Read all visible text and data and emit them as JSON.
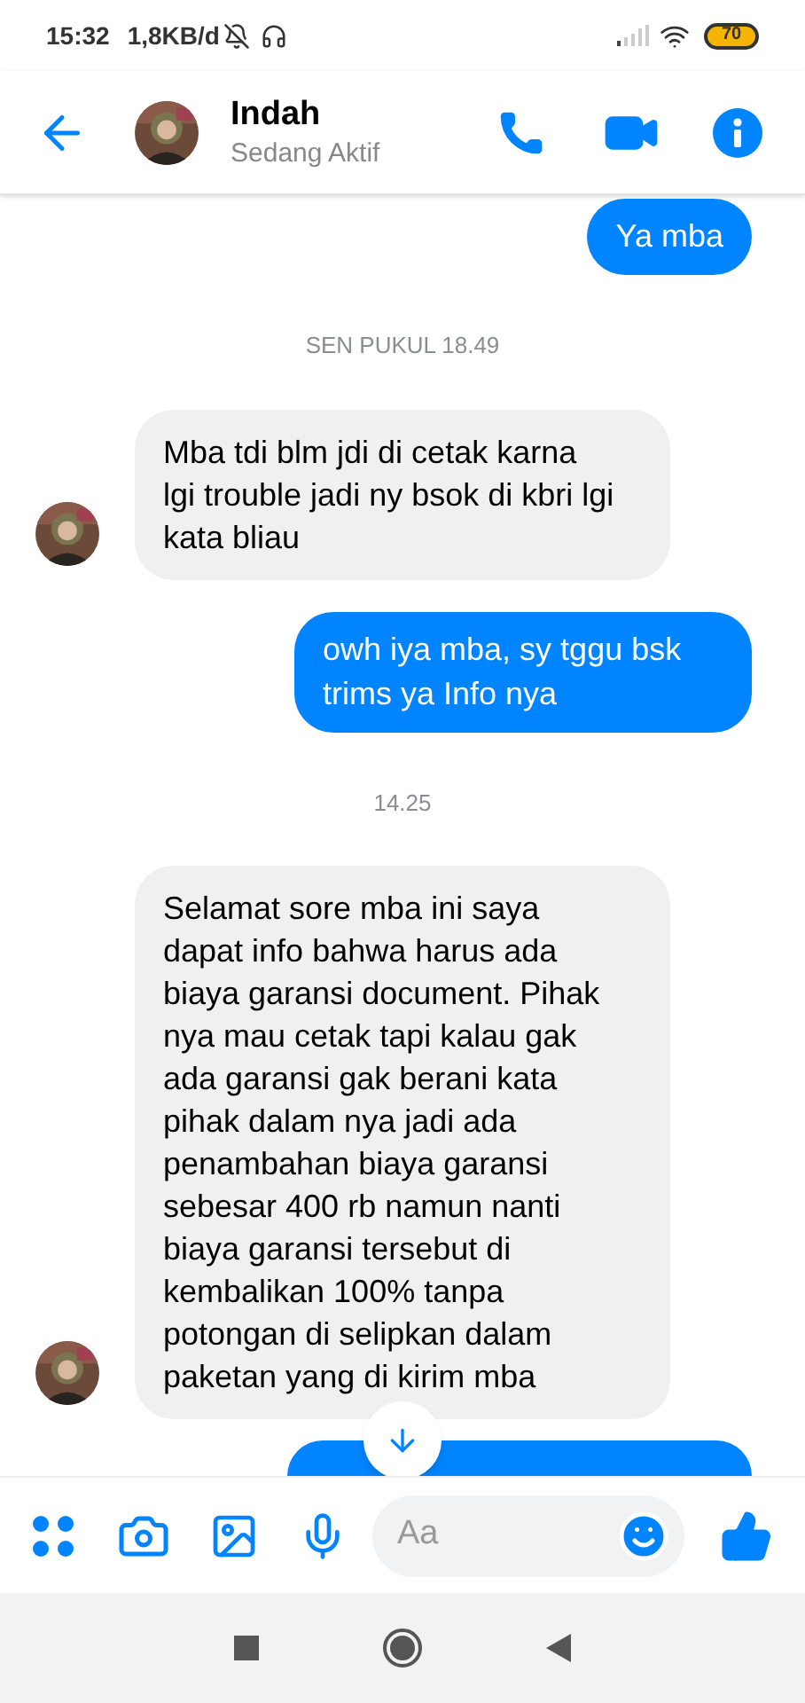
{
  "status_bar": {
    "time": "15:32",
    "speed": "1,8KB/d",
    "battery": "70"
  },
  "header": {
    "name": "Indah",
    "status": "Sedang Aktif"
  },
  "messages": [
    {
      "kind": "sent",
      "text": "Ya mba"
    },
    {
      "kind": "time",
      "text": "SEN PUKUL 18.49"
    },
    {
      "kind": "received",
      "text": "Mba tdi blm jdi di cetak karna lgi trouble jadi ny bsok di kbri lgi kata bliau",
      "avatar": true
    },
    {
      "kind": "sent",
      "text": "owh iya mba, sy tggu bsk trims ya Info nya"
    },
    {
      "kind": "time",
      "text": "14.25"
    },
    {
      "kind": "received",
      "text": "Selamat sore mba ini saya dapat info bahwa harus ada biaya garansi document. Pihak nya mau cetak tapi kalau gak ada garansi gak berani kata pihak dalam nya jadi ada penambahan biaya garansi sebesar 400 rb namun nanti biaya garansi tersebut di kembalikan 100% tanpa potongan di selipkan dalam paketan yang di kirim mba",
      "avatar": true
    }
  ],
  "composer": {
    "placeholder": "Aa"
  }
}
